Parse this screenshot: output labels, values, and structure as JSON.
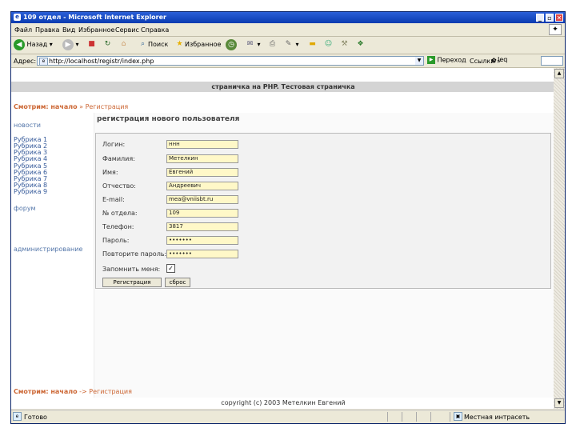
{
  "window": {
    "title": "109 отдел - Microsoft Internet Explorer",
    "min": "_",
    "max": "▫",
    "close": "✕"
  },
  "menu": [
    "Файл",
    "Правка",
    "Вид",
    "Избранное",
    "Сервис",
    "Справка"
  ],
  "toolbar": {
    "back": "Назад",
    "search": "Поиск",
    "favorites": "Избранное"
  },
  "address": {
    "label": "Адрес:",
    "url": "http://localhost/registr/index.php",
    "go": "Переход",
    "links": "Ссылки",
    "chev": "»",
    "tb": "Ieq"
  },
  "page": {
    "site_header": "страничка на PHP. Тестовая страничка",
    "breadcrumb": {
      "home": "Смотрим: начало",
      "sep": " » ",
      "current": "Регистрация"
    },
    "breadcrumb_bottom": {
      "home": "Смотрим: начало",
      "sep": " -> ",
      "current": "Регистрация"
    },
    "nav": {
      "news": "новости",
      "rubrics": [
        "Рубрика 1",
        "Рубрика 2",
        "Рубрика 3",
        "Рубрика 4",
        "Рубрика 5",
        "Рубрика 6",
        "Рубрика 7",
        "Рубрика 8",
        "Рубрика 9"
      ],
      "forum": "форум",
      "admin": "администрирование"
    },
    "form": {
      "title": "регистрация нового пользователя",
      "fields": [
        {
          "label": "Логин:",
          "value": "ннн"
        },
        {
          "label": "Фамилия:",
          "value": "Метелкин"
        },
        {
          "label": "Имя:",
          "value": "Евгений"
        },
        {
          "label": "Отчество:",
          "value": "Андреевич"
        },
        {
          "label": "E-mail:",
          "value": "mea@vniisbt.ru"
        },
        {
          "label": "№ отдела:",
          "value": "109"
        },
        {
          "label": "Телефон:",
          "value": "3817"
        },
        {
          "label": "Пароль:",
          "value": "•••••••"
        },
        {
          "label": "Повторите пароль:",
          "value": "•••••••"
        }
      ],
      "remember_label": "Запомнить меня:",
      "remember_checked": "✓",
      "submit": "Регистрация",
      "reset": "сброс"
    },
    "footer": "copyright (c) 2003 Метелкин Евгений"
  },
  "status": {
    "text": "Готово",
    "zone": "Местная интрасеть"
  }
}
